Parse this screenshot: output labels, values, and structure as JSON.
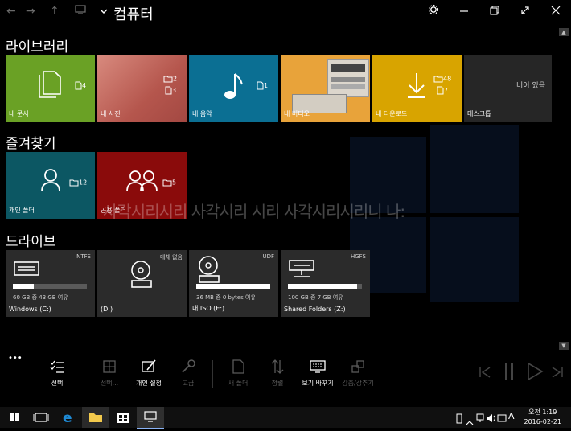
{
  "window": {
    "title": "컴퓨터",
    "nav": {
      "back": "←",
      "forward": "→",
      "up": "↑"
    }
  },
  "sections": {
    "libraries": "라이브러리",
    "favorites": "즐겨찾기",
    "drives": "드라이브"
  },
  "libraries": [
    {
      "label": "내 문서",
      "folders": "",
      "files": "4",
      "color": "#6aa125"
    },
    {
      "label": "내 사진",
      "folders": "2",
      "files": "3",
      "color": "#c8685e"
    },
    {
      "label": "내 음악",
      "folders": "",
      "files": "1",
      "color": "#0b6f93"
    },
    {
      "label": "내 비디오",
      "folders": "",
      "files": "",
      "color": "#e8a33a"
    },
    {
      "label": "내 다운로드",
      "folders": "48",
      "files": "7",
      "color": "#d8a400"
    },
    {
      "label": "데스크톱",
      "status": "비어 있음",
      "color": "#262626"
    }
  ],
  "favorites": [
    {
      "label": "개인 폴더",
      "folders": "12",
      "color": "#0c5763"
    },
    {
      "label": "공용 폴더",
      "folders": "5",
      "color": "#8a0b0b"
    }
  ],
  "overlay_text": "사각시리시리 사각시리 시리 사각시리시리니 나:",
  "drives": [
    {
      "name": "Windows (C:)",
      "fs": "NTFS",
      "info": "60 GB 중 43 GB 여유",
      "used_fraction": 0.28
    },
    {
      "name": "(D:)",
      "fs": "매체 없음",
      "info": ""
    },
    {
      "name": "내 ISO (E:)",
      "fs": "UDF",
      "info": "36 MB 중 0 bytes 여유",
      "used_fraction": 1.0
    },
    {
      "name": "Shared Folders (Z:)",
      "fs": "HGFS",
      "info": "100 GB 중 7 GB 여유",
      "used_fraction": 0.93
    }
  ],
  "appbar": {
    "more": "•••",
    "select": "선택",
    "select_all": "선택...",
    "personalize": "개인 설정",
    "advanced": "고급",
    "new_folder": "새 폴더",
    "sort": "정렬",
    "view": "보기 바꾸기",
    "hide": "감춤/감추기"
  },
  "taskbar": {
    "time": "오전 1:19",
    "date": "2016-02-21",
    "ime": "A"
  }
}
